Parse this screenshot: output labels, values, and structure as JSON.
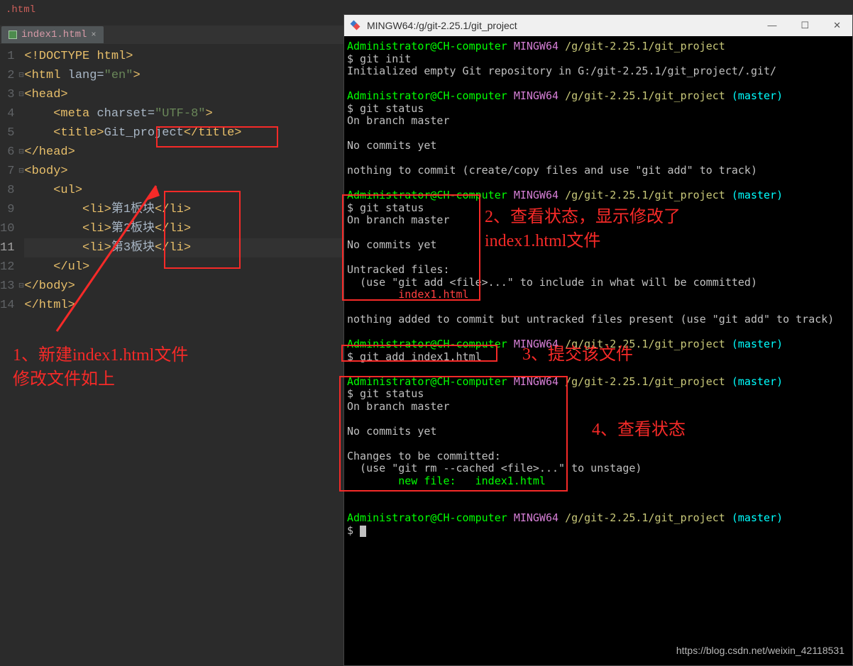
{
  "editor": {
    "filepath": ".html",
    "tab": "index1.html",
    "lines": [
      "1",
      "2",
      "3",
      "4",
      "5",
      "6",
      "7",
      "8",
      "9",
      "10",
      "11",
      "12",
      "13",
      "14"
    ],
    "code": {
      "l1a": "<!DOCTYPE ",
      "l1b": "html",
      "l1c": ">",
      "l2a": "<html ",
      "l2b": "lang=",
      "l2c": "\"en\"",
      "l2d": ">",
      "l3": "<head>",
      "l4a": "<meta ",
      "l4b": "charset=",
      "l4c": "\"UTF-8\"",
      "l4d": ">",
      "l5a": "<title>",
      "l5b": "Git_project",
      "l5c": "</title>",
      "l6": "</head>",
      "l7": "<body>",
      "l8": "<ul>",
      "l9a": "<li>",
      "l9b": "第1板块",
      "l9c": "</li>",
      "l10a": "<li>",
      "l10b": "第2板块",
      "l10c": "</li>",
      "l11a": "<li>",
      "l11b": "第3板块",
      "l11c": "</li>",
      "l12": "</ul>",
      "l13": "</body>",
      "l14": "</html>"
    }
  },
  "window": {
    "title": "MINGW64:/g/git-2.25.1/git_project"
  },
  "terminal": {
    "prompt_user": "Administrator@CH-computer",
    "prompt_env": "MINGW64",
    "prompt_path": "/g/git-2.25.1/git_project",
    "branch": "(master)",
    "cmd_init": "$ git init",
    "init_out": "Initialized empty Git repository in G:/git-2.25.1/git_project/.git/",
    "cmd_status": "$ git status",
    "on_branch": "On branch master",
    "no_commits": "No commits yet",
    "nothing_commit": "nothing to commit (create/copy files and use \"git add\" to track)",
    "untracked_hdr": "Untracked files:",
    "untracked_hint": "  (use \"git add <file>...\" to include in what will be committed)",
    "untracked_file": "        index1.html",
    "nothing_added": "nothing added to commit but untracked files present (use \"git add\" to track)",
    "cmd_add": "$ git add index1.html",
    "changes_hdr": "Changes to be committed:",
    "changes_hint": "  (use \"git rm --cached <file>...\" to unstage)",
    "new_file": "        new file:   index1.html",
    "dollar": "$ "
  },
  "annotations": {
    "a1": "1、新建index1.html文件\n修改文件如上",
    "a2": "2、查看状态，显示修改了\nindex1.html文件",
    "a3": "3、提交该文件",
    "a4": "4、查看状态"
  },
  "watermark": "https://blog.csdn.net/weixin_42118531"
}
